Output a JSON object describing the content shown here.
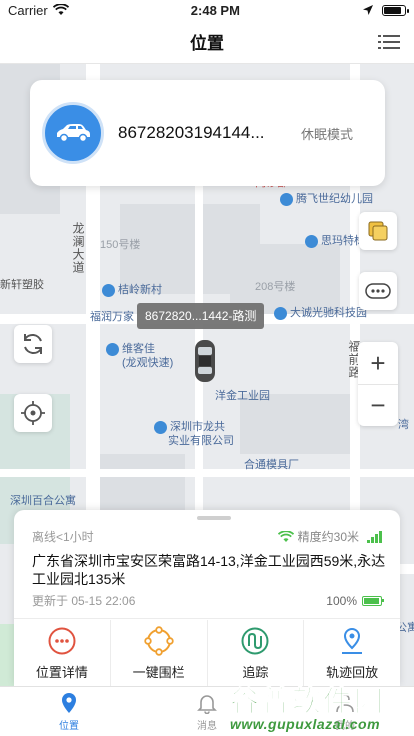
{
  "status_bar": {
    "carrier": "Carrier",
    "time": "2:48 PM",
    "battery_level": 0.9
  },
  "nav": {
    "title": "位置"
  },
  "map": {
    "labels": {
      "road_longlan": "龙澜大道",
      "road_fuqiao": "福前路",
      "tengfei": "腾飞世纪幼儿园",
      "side_top": "门诊部",
      "siqi": "思玛特标",
      "no150": "150号楼",
      "xuan": "新轩塑胶",
      "juling": "桔岭新村",
      "no208": "208号楼",
      "datcheng": "大诚光驰科技园",
      "fuyun": "福润万家",
      "weike": "维客佳",
      "weike_sub": "(龙观快速)",
      "yangjin": "洋金工业园",
      "longgong": "深圳市龙共",
      "longgong_sub": "实业有限公司",
      "hecheng": "合通模具厂",
      "baihe": "深圳百合公寓",
      "edge_right": "湾",
      "edge_right2": "公寓"
    },
    "marker": {
      "label": "8672820...1442-路测"
    }
  },
  "device": {
    "id": "86728203194144...",
    "mode": "休眠模式"
  },
  "info": {
    "offline": "离线<1小时",
    "precision": "精度约30米",
    "address": "广东省深圳市宝安区荣富路14-13,洋金工业园西59米,永达工业园北135米",
    "updated": "更新于 05-15 22:06",
    "battery": "100%",
    "battery_level": 1.0
  },
  "actions": [
    {
      "label": "位置详情",
      "icon": "dots-circle-icon",
      "color": "#e0533f"
    },
    {
      "label": "一键围栏",
      "icon": "fence-circle-icon",
      "color": "#f0a030"
    },
    {
      "label": "追踪",
      "icon": "track-icon",
      "color": "#2e9a6e"
    },
    {
      "label": "轨迹回放",
      "icon": "pin-route-icon",
      "color": "#3a8ee6"
    }
  ],
  "tabs": [
    {
      "label": "位置",
      "icon": "location-pin-icon"
    },
    {
      "label": "消息",
      "icon": "bell-icon"
    },
    {
      "label": "我的",
      "icon": "user-icon"
    }
  ],
  "watermark": {
    "title": "谷普软件园",
    "url": "www.gupuxlazal.com"
  },
  "colors": {
    "primary": "#2d7fe0",
    "green": "#4cc04c"
  }
}
